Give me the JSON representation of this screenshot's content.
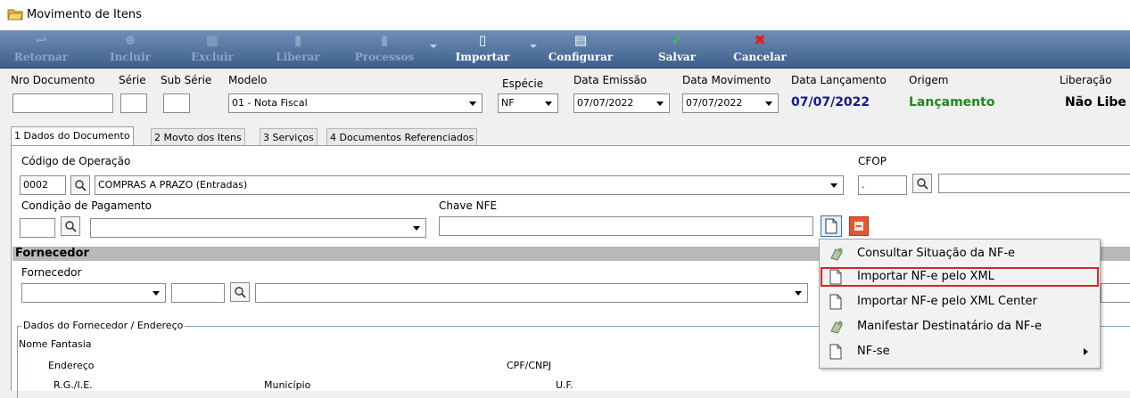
{
  "window": {
    "title": "Movimento de Itens"
  },
  "toolbar": {
    "retornar": "Retornar",
    "incluir": "Incluir",
    "excluir": "Excluir",
    "liberar": "Liberar",
    "processos": "Processos",
    "importar": "Importar",
    "configurar": "Configurar",
    "salvar": "Salvar",
    "cancelar": "Cancelar"
  },
  "header": {
    "nro_documento_label": "Nro Documento",
    "serie_label": "Série",
    "sub_serie_label": "Sub Série",
    "modelo_label": "Modelo",
    "modelo_value": "01 - Nota Fiscal",
    "especie_label": "Espécie",
    "especie_value": "NF",
    "data_emissao_label": "Data Emissão",
    "data_emissao_value": "07/07/2022",
    "data_movimento_label": "Data Movimento",
    "data_movimento_value": "07/07/2022",
    "data_lancamento_label": "Data Lançamento",
    "data_lancamento_value": "07/07/2022",
    "origem_label": "Origem",
    "origem_value": "Lançamento",
    "liberacao_label": "Liberação",
    "liberacao_value": "Não Libe"
  },
  "tabs": [
    {
      "label": "1 Dados do Documento"
    },
    {
      "label": "2 Movto dos Itens"
    },
    {
      "label": "3 Serviços"
    },
    {
      "label": "4 Documentos Referenciados"
    }
  ],
  "documento": {
    "codigo_operacao_label": "Código de Operação",
    "codigo_operacao_value": "0002",
    "operacao_desc": "COMPRAS A PRAZO (Entradas)",
    "cfop_label": "CFOP",
    "cfop_value": ".",
    "condicao_pagamento_label": "Condição de Pagamento",
    "chave_nfe_label": "Chave NFE"
  },
  "fornecedor": {
    "section_title": "Fornecedor",
    "fornecedor_label": "Fornecedor",
    "group_title": "Dados do Fornecedor / Endereço",
    "nome_fantasia_label": "Nome Fantasia",
    "endereco_label": "Endereço",
    "cpf_cnpj_label": "CPF/CNPJ",
    "rg_ie_label": "R.G./I.E.",
    "municipio_label": "Município",
    "uf_label": "U.F."
  },
  "menu": {
    "items": [
      {
        "label": "Consultar Situação da NF-e",
        "icon": "nfe-status-icon"
      },
      {
        "label": "Importar NF-e pelo XML",
        "icon": "xml-document-icon"
      },
      {
        "label": "Importar NF-e pelo XML Center",
        "icon": "xml-document-icon"
      },
      {
        "label": "Manifestar Destinatário da NF-e",
        "icon": "nfe-status-icon"
      },
      {
        "label": "NF-se",
        "icon": "xml-document-icon"
      }
    ]
  },
  "colors": {
    "toolbar": "#4f6f9d",
    "date_blue": "#1a1a8c",
    "origem_green": "#1f8a1f",
    "highlight_red": "#d9252b"
  }
}
